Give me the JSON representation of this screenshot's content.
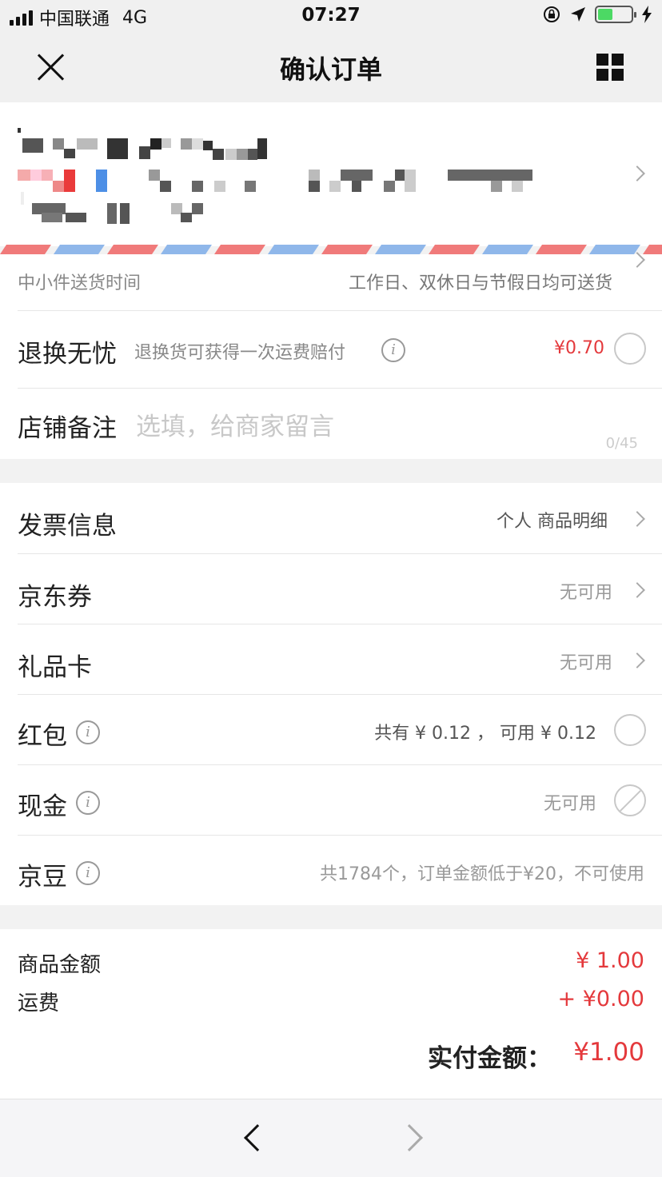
{
  "status_bar": {
    "carrier": "中国联通",
    "network": "4G",
    "time": "07:27"
  },
  "nav": {
    "title": "确认订单"
  },
  "delivery": {
    "label": "中小件送货时间",
    "value": "工作日、双休日与节假日均可送货"
  },
  "return_worry_free": {
    "label": "退换无忧",
    "desc": "退换货可获得一次运费赔付",
    "price": "¥0.70"
  },
  "store_note": {
    "label": "店铺备注",
    "placeholder": "选填，给商家留言",
    "counter": "0/45"
  },
  "payment_options": [
    {
      "label": "发票信息",
      "value": "个人  商品明细"
    },
    {
      "label": "京东券",
      "value": "无可用"
    },
    {
      "label": "礼品卡",
      "value": "无可用"
    },
    {
      "label": "红包",
      "value": "共有 ¥ 0.12 ， 可用 ¥ 0.12"
    },
    {
      "label": "现金",
      "value": "无可用"
    },
    {
      "label": "京豆",
      "value": "共1784个，订单金额低于¥20，不可使用"
    }
  ],
  "summary": {
    "goods_label": "商品金额",
    "goods_value": "¥ 1.00",
    "shipping_label": "运费",
    "shipping_value": "+ ¥0.00",
    "total_label": "实付金额：",
    "total_value": "¥1.00"
  },
  "colors": {
    "accent_red": "#e4393c",
    "airmail_red": "#f07a7a",
    "airmail_blue": "#8fb7ea"
  }
}
